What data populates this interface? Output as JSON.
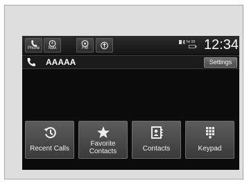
{
  "status_bar": {
    "sources": [
      {
        "label": "Phone",
        "icon": "phone-icon"
      },
      {
        "label": "Navi",
        "icon": "compass-icon"
      },
      {
        "label": "FM",
        "icon": "radio-icon"
      },
      {
        "label": "",
        "icon": "broadcast-icon"
      }
    ],
    "status_text": "Tel 99",
    "time": "12:34"
  },
  "call": {
    "name": "AAAAA",
    "settings_label": "Settings"
  },
  "menu": [
    {
      "label": "Recent Calls",
      "icon": "history-icon"
    },
    {
      "label": "Favorite Contacts",
      "label_lines": [
        "Favorite",
        "Contacts"
      ],
      "icon": "star-icon"
    },
    {
      "label": "Contacts",
      "icon": "contacts-book-icon"
    },
    {
      "label": "Keypad",
      "icon": "keypad-icon"
    }
  ]
}
